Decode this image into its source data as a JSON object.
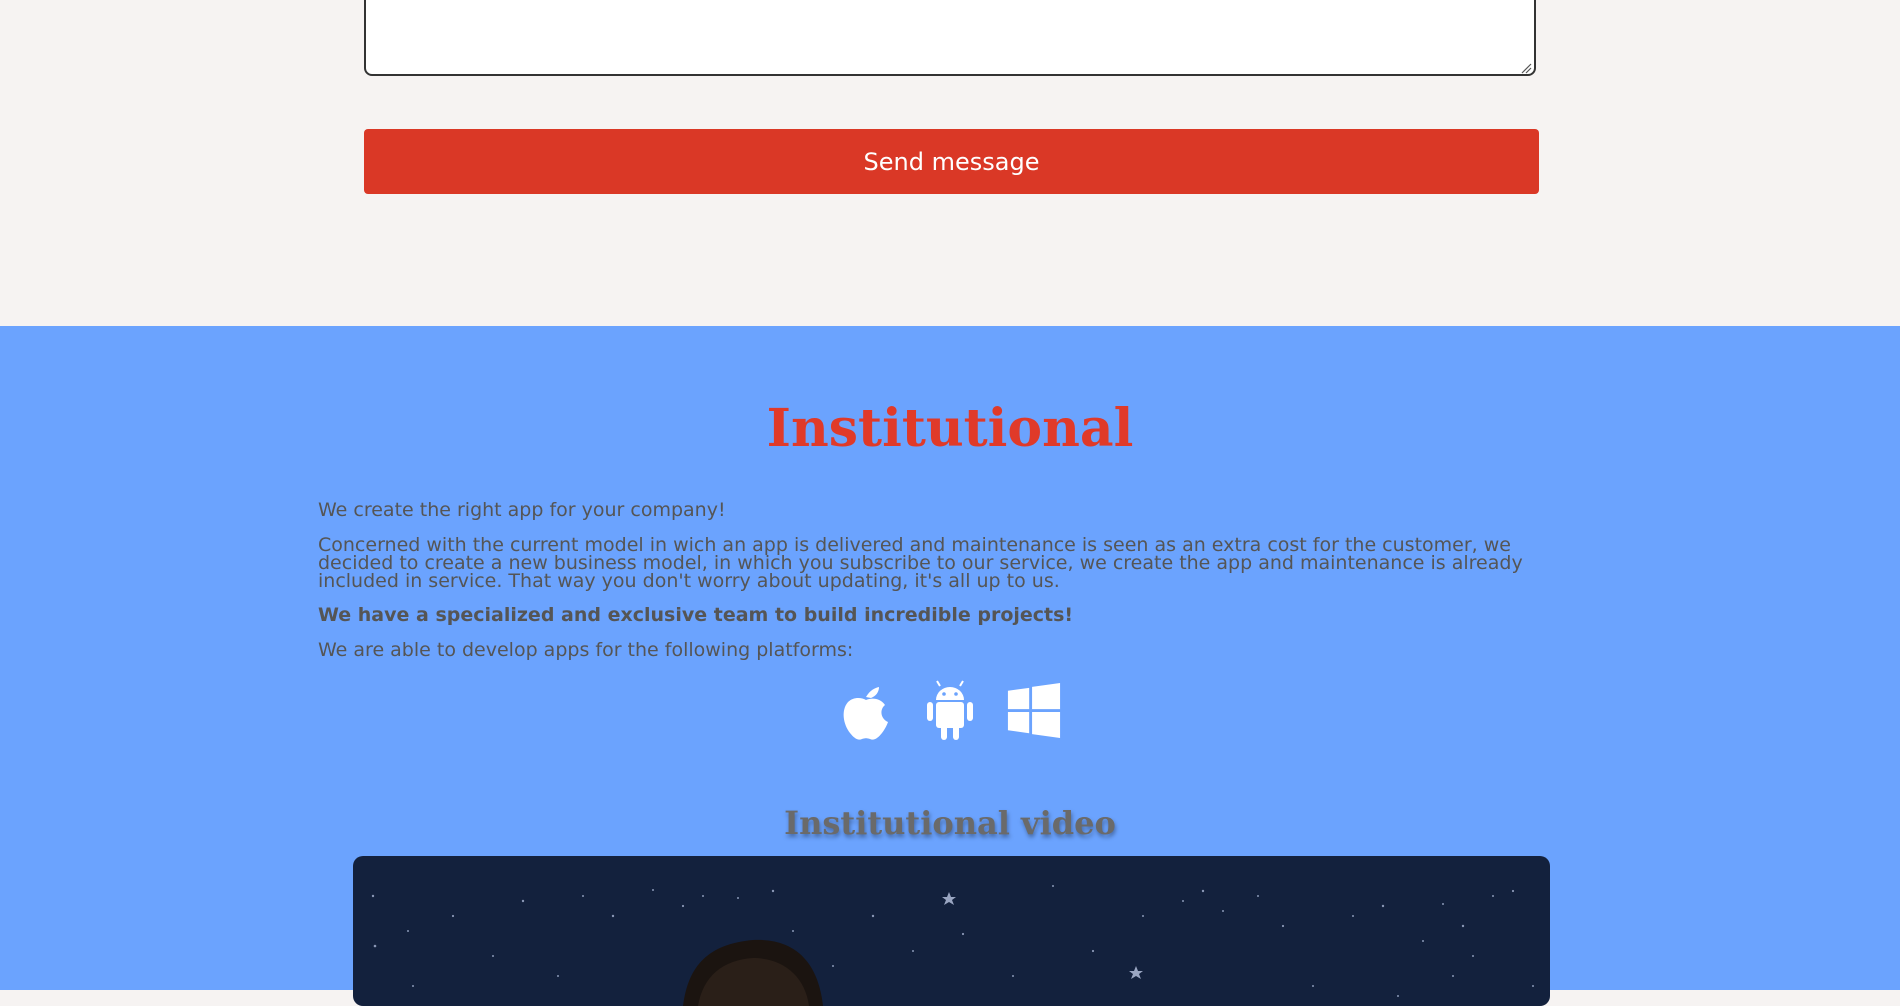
{
  "contact": {
    "message_value": "",
    "send_label": "Send message"
  },
  "institutional": {
    "title": "Institutional",
    "intro": "We create the right app for your company!",
    "description": "Concerned with the current model in wich an app is delivered and maintenance is seen as an extra cost for the customer, we decided to create a new business model, in which you subscribe to our service, we create the app and maintenance is already included in service. That way you don't worry about updating, it's all up to us.",
    "team": "We have a specialized and exclusive team to build incredible projects!",
    "platforms_intro": "We are able to develop apps for the following platforms:",
    "platforms": [
      "apple-icon",
      "android-icon",
      "windows-icon"
    ],
    "video_title": "Institutional video"
  },
  "colors": {
    "accent_red": "#da3826",
    "section_blue": "#6ba3fe",
    "light_bg": "#f6f3f2",
    "video_bg": "#13213d"
  }
}
